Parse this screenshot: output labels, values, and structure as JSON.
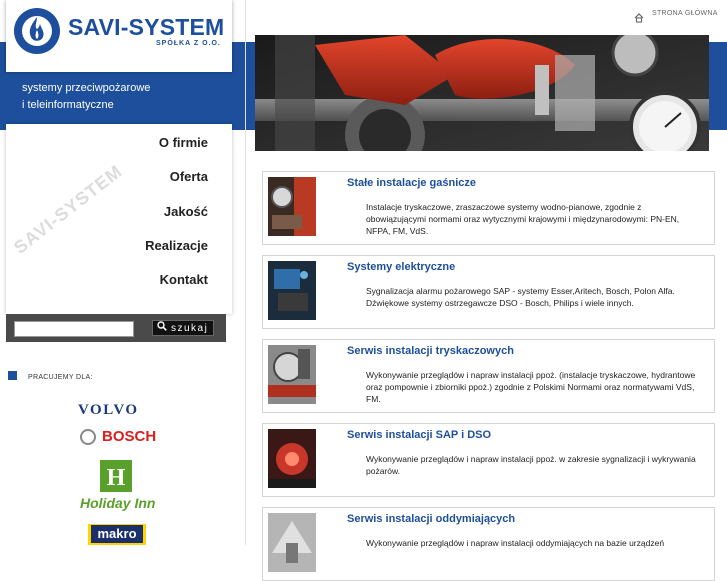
{
  "brand": {
    "name": "SAVI-SYSTEM",
    "subname": "SPÓŁKA Z O.O.",
    "tagline_line1": "systemy przeciwpożarowe",
    "tagline_line2": "i teleinformatyczne",
    "watermark": "SAVI-SYSTEM"
  },
  "header": {
    "home_link": "STRONA GŁÓWNA"
  },
  "nav": {
    "items": [
      {
        "label": "O firmie"
      },
      {
        "label": "Oferta"
      },
      {
        "label": "Jakość"
      },
      {
        "label": "Realizacje"
      },
      {
        "label": "Kontakt"
      }
    ]
  },
  "search": {
    "value": "",
    "button_label": "szukaj"
  },
  "partners": {
    "label": "PRACUJEMY DLA:",
    "logos": {
      "volvo": "VOLVO",
      "bosch": "BOSCH",
      "holiday_inn": "Holiday Inn",
      "makro": "makro"
    }
  },
  "services": [
    {
      "title": "Stałe instalacje gaśnicze",
      "desc": "Instalacje tryskaczowe, zraszaczowe systemy wodno-pianowe, zgodnie z obowiązującymi normami oraz wytycznymi krajowymi i międzynarodowymi: PN-EN, NFPA, FM, VdS."
    },
    {
      "title": "Systemy elektryczne",
      "desc": "Sygnalizacja alarmu pożarowego SAP - systemy Esser,Aritech, Bosch, Polon Alfa. Dźwiękowe systemy ostrzegawcze DSO - Bosch, Philips i wiele innych."
    },
    {
      "title": "Serwis instalacji tryskaczowych",
      "desc": "Wykonywanie przeglądów i napraw instalacji ppoż. (instalacje tryskaczowe, hydrantowe oraz pompownie i zbiorniki ppoż.) zgodnie z Polskimi Normami oraz normatywami VdS, FM."
    },
    {
      "title": "Serwis instalacji SAP i DSO",
      "desc": "Wykonywanie przeglądów i napraw instalacji ppoż. w zakresie sygnalizacji i wykrywania pożarów."
    },
    {
      "title": "Serwis instalacji oddymiających",
      "desc": "Wykonywanie przeglądów i napraw instalacji oddymiających na bazie urządzeń"
    }
  ]
}
